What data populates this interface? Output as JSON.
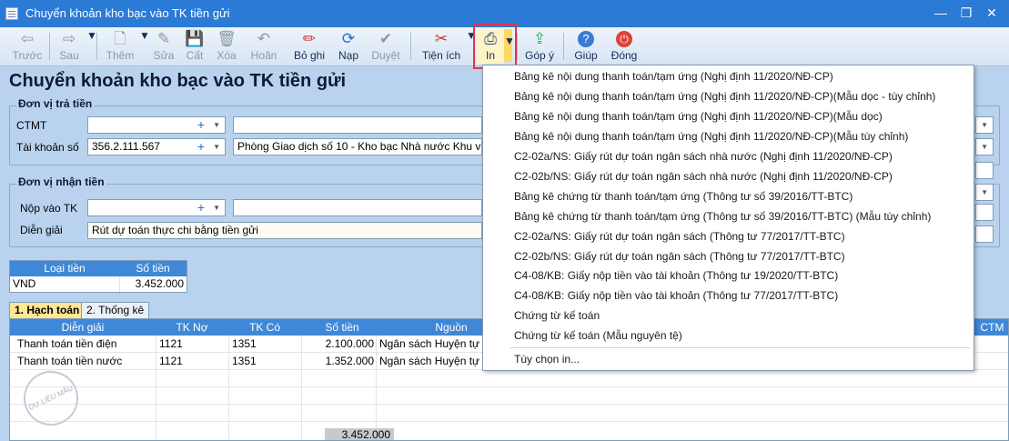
{
  "window": {
    "title": "Chuyển khoản kho bạc vào TK tiền gửi",
    "minimize": "—",
    "maximize": "❐",
    "close": "✕"
  },
  "toolbar": {
    "items": [
      {
        "label": "Trước",
        "icon": "back-arrow-icon",
        "glyph": "⇦",
        "enabled": false
      },
      {
        "label": "Sau",
        "icon": "forward-arrow-icon",
        "glyph": "⇨",
        "enabled": false
      },
      {
        "label": "Thêm",
        "icon": "new-document-icon",
        "glyph": "🗋",
        "enabled": false
      },
      {
        "label": "Sửa",
        "icon": "edit-icon",
        "glyph": "✎",
        "enabled": false
      },
      {
        "label": "Cất",
        "icon": "save-icon",
        "glyph": "💾",
        "enabled": false
      },
      {
        "label": "Xóa",
        "icon": "delete-icon",
        "glyph": "🗑",
        "enabled": false
      },
      {
        "label": "Hoãn",
        "icon": "undo-icon",
        "glyph": "↶",
        "enabled": false
      },
      {
        "label": "Bỏ ghi",
        "icon": "unpost-icon",
        "glyph": "✏",
        "enabled": true
      },
      {
        "label": "Nạp",
        "icon": "refresh-icon",
        "glyph": "⟳",
        "enabled": true
      },
      {
        "label": "Duyệt",
        "icon": "approve-check-icon",
        "glyph": "✔",
        "enabled": false
      },
      {
        "label": "Tiện ích",
        "icon": "tools-icon",
        "glyph": "✂",
        "enabled": true
      },
      {
        "label": "In",
        "icon": "printer-icon",
        "glyph": "⎙",
        "enabled": true
      },
      {
        "label": "Góp ý",
        "icon": "feedback-icon",
        "glyph": "⇪",
        "enabled": true
      },
      {
        "label": "Giúp",
        "icon": "help-icon",
        "glyph": "?",
        "enabled": true
      },
      {
        "label": "Đóng",
        "icon": "power-icon",
        "glyph": "⏻",
        "enabled": true
      }
    ]
  },
  "form": {
    "title": "Chuyển khoản kho bạc vào TK tiền gửi",
    "payer_group": "Đơn vị trả tiền",
    "ctmt_label": "CTMT",
    "ctmt_value": "",
    "account_label": "Tài khoản số",
    "account_value": "356.2.111.567",
    "account_name": "Phòng Giao dịch số 10 - Kho bạc Nhà nước Khu vực I",
    "payee_group": "Đơn vị nhận tiền",
    "deposit_label": "Nộp vào TK",
    "deposit_value": "",
    "desc_label": "Diễn giải",
    "desc_value": "Rút dự toán thực chi bằng tiền gửi"
  },
  "currency_table": {
    "headers": [
      "Loại tiền",
      "Số tiền"
    ],
    "row": [
      "VND",
      "3.452.000"
    ]
  },
  "tabs": [
    "1. Hạch toán",
    "2. Thống kê"
  ],
  "grid": {
    "headers": [
      "Diễn giải",
      "TK Nợ",
      "TK Có",
      "Số tiền",
      "Nguồn",
      "CTM"
    ],
    "rows": [
      [
        "Thanh toán tiền điện",
        "1121",
        "1351",
        "2.100.000",
        "Ngân sách Huyện tự ch"
      ],
      [
        "Thanh toán tiền nước",
        "1121",
        "1351",
        "1.352.000",
        "Ngân sách Huyện tự ch"
      ]
    ],
    "total": "3.452.000"
  },
  "watermark": "DỰ LIỆU MẪU",
  "print_menu": {
    "items": [
      "Bảng kê nội dung thanh toán/tạm ứng (Nghị định 11/2020/NĐ-CP)",
      "Bảng kê nội dung thanh toán/tạm ứng (Nghị định 11/2020/NĐ-CP)(Mẫu dọc - tùy chỉnh)",
      "Bảng kê nội dung thanh toán/tạm ứng (Nghị định 11/2020/NĐ-CP)(Mẫu dọc)",
      "Bảng kê nội dung thanh toán/tạm ứng (Nghị định 11/2020/NĐ-CP)(Mẫu tùy chỉnh)",
      "C2-02a/NS: Giấy rút dự toán ngân sách nhà nước (Nghị định 11/2020/NĐ-CP)",
      "C2-02b/NS: Giấy rút dự toán ngân sách nhà nước (Nghị định 11/2020/NĐ-CP)",
      "Bảng kê chứng từ thanh toán/tạm ứng (Thông tư số 39/2016/TT-BTC)",
      "Bảng kê chứng từ thanh toán/tạm ứng (Thông tư số 39/2016/TT-BTC) (Mẫu tùy chỉnh)",
      "C2-02a/NS: Giấy rút dự toán ngân sách (Thông tư 77/2017/TT-BTC)",
      "C2-02b/NS: Giấy rút dự toán ngân sách (Thông tư 77/2017/TT-BTC)",
      "C4-08/KB: Giấy nộp tiền vào tài khoản (Thông tư 19/2020/TT-BTC)",
      "C4-08/KB: Giấy nộp tiền vào tài khoản (Thông tư 77/2017/TT-BTC)",
      "Chứng từ kế toán",
      "Chứng từ kế toán (Mẫu nguyên tệ)"
    ],
    "options": "Tùy chọn in..."
  }
}
